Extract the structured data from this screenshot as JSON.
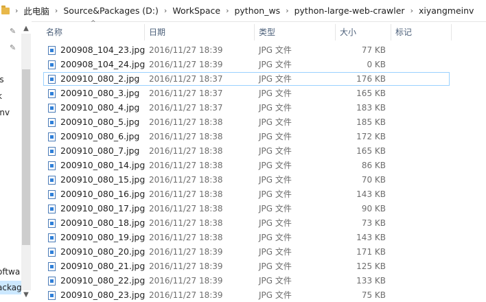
{
  "breadcrumb": {
    "items": [
      "此电脑",
      "Source&Packages (D:)",
      "WorkSpace",
      "python_ws",
      "python-large-web-crawler",
      "xiyangmeinv"
    ],
    "separator": "›"
  },
  "nav": {
    "partial_labels": [
      "ls",
      "k",
      "inv",
      "oftwa",
      "ackag"
    ]
  },
  "columns": {
    "name": "名称",
    "date": "日期",
    "type": "类型",
    "size": "大小",
    "tags": "标记"
  },
  "files": [
    {
      "name": "200908_104_23.jpg",
      "date": "2016/11/27 18:39",
      "type": "JPG 文件",
      "size": "77 KB"
    },
    {
      "name": "200908_104_24.jpg",
      "date": "2016/11/27 18:39",
      "type": "JPG 文件",
      "size": "0 KB"
    },
    {
      "name": "200910_080_2.jpg",
      "date": "2016/11/27 18:37",
      "type": "JPG 文件",
      "size": "176 KB"
    },
    {
      "name": "200910_080_3.jpg",
      "date": "2016/11/27 18:37",
      "type": "JPG 文件",
      "size": "165 KB"
    },
    {
      "name": "200910_080_4.jpg",
      "date": "2016/11/27 18:37",
      "type": "JPG 文件",
      "size": "183 KB"
    },
    {
      "name": "200910_080_5.jpg",
      "date": "2016/11/27 18:38",
      "type": "JPG 文件",
      "size": "185 KB"
    },
    {
      "name": "200910_080_6.jpg",
      "date": "2016/11/27 18:38",
      "type": "JPG 文件",
      "size": "172 KB"
    },
    {
      "name": "200910_080_7.jpg",
      "date": "2016/11/27 18:38",
      "type": "JPG 文件",
      "size": "165 KB"
    },
    {
      "name": "200910_080_14.jpg",
      "date": "2016/11/27 18:38",
      "type": "JPG 文件",
      "size": "86 KB"
    },
    {
      "name": "200910_080_15.jpg",
      "date": "2016/11/27 18:38",
      "type": "JPG 文件",
      "size": "70 KB"
    },
    {
      "name": "200910_080_16.jpg",
      "date": "2016/11/27 18:38",
      "type": "JPG 文件",
      "size": "143 KB"
    },
    {
      "name": "200910_080_17.jpg",
      "date": "2016/11/27 18:38",
      "type": "JPG 文件",
      "size": "90 KB"
    },
    {
      "name": "200910_080_18.jpg",
      "date": "2016/11/27 18:38",
      "type": "JPG 文件",
      "size": "73 KB"
    },
    {
      "name": "200910_080_19.jpg",
      "date": "2016/11/27 18:38",
      "type": "JPG 文件",
      "size": "143 KB"
    },
    {
      "name": "200910_080_20.jpg",
      "date": "2016/11/27 18:39",
      "type": "JPG 文件",
      "size": "171 KB"
    },
    {
      "name": "200910_080_21.jpg",
      "date": "2016/11/27 18:39",
      "type": "JPG 文件",
      "size": "125 KB"
    },
    {
      "name": "200910_080_22.jpg",
      "date": "2016/11/27 18:39",
      "type": "JPG 文件",
      "size": "133 KB"
    },
    {
      "name": "200910_080_23.jpg",
      "date": "2016/11/27 18:39",
      "type": "JPG 文件",
      "size": "75 KB"
    }
  ],
  "focused_row_index": 2,
  "colors": {
    "header_text": "#4c607a",
    "focus_border": "#99d1ff",
    "selection_bg": "#cce8ff"
  }
}
